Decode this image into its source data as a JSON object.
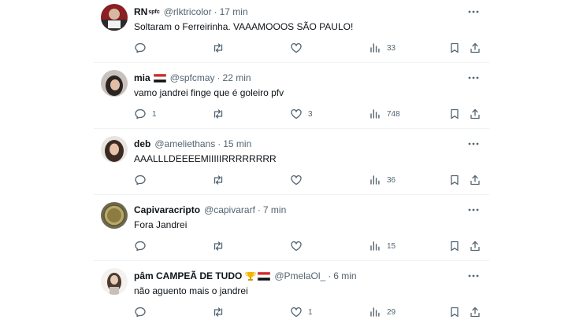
{
  "colors": {
    "text": "#0f1419",
    "muted": "#536471",
    "divider": "#eff3f4",
    "background": "#ffffff"
  },
  "tweets": [
    {
      "display_name": "RN",
      "name_suffix": "spfc",
      "badge": "",
      "handle": "@rlktricolor",
      "time": "17 min",
      "text": "Soltaram o Ferreirinha. VAAAMOOOS SÃO PAULO!",
      "replies": "",
      "likes": "",
      "views": "33"
    },
    {
      "display_name": "mia",
      "name_suffix": "",
      "badge": "flag-icon",
      "handle": "@spfcmay",
      "time": "22 min",
      "text": "vamo jandrei finge que é goleiro pfv",
      "replies": "1",
      "likes": "3",
      "views": "748"
    },
    {
      "display_name": "deb",
      "name_suffix": "",
      "badge": "",
      "handle": "@ameliethans",
      "time": "15 min",
      "text": "AAALLLDEEEEMIIIIIRRRRRRRR",
      "replies": "",
      "likes": "",
      "views": "36"
    },
    {
      "display_name": "Capivaracripto",
      "name_suffix": "",
      "badge": "",
      "handle": "@capivararf",
      "time": "7 min",
      "text": "Fora Jandrei",
      "replies": "",
      "likes": "",
      "views": "15"
    },
    {
      "display_name": "pâm CAMPEÃ DE TUDO",
      "name_suffix": "",
      "badge": "trophy-and-flag-icon",
      "handle": "@PmelaOl_",
      "time": "6 min",
      "text": "não aguento mais o jandrei",
      "replies": "",
      "likes": "1",
      "views": "29"
    }
  ],
  "separator": "·"
}
